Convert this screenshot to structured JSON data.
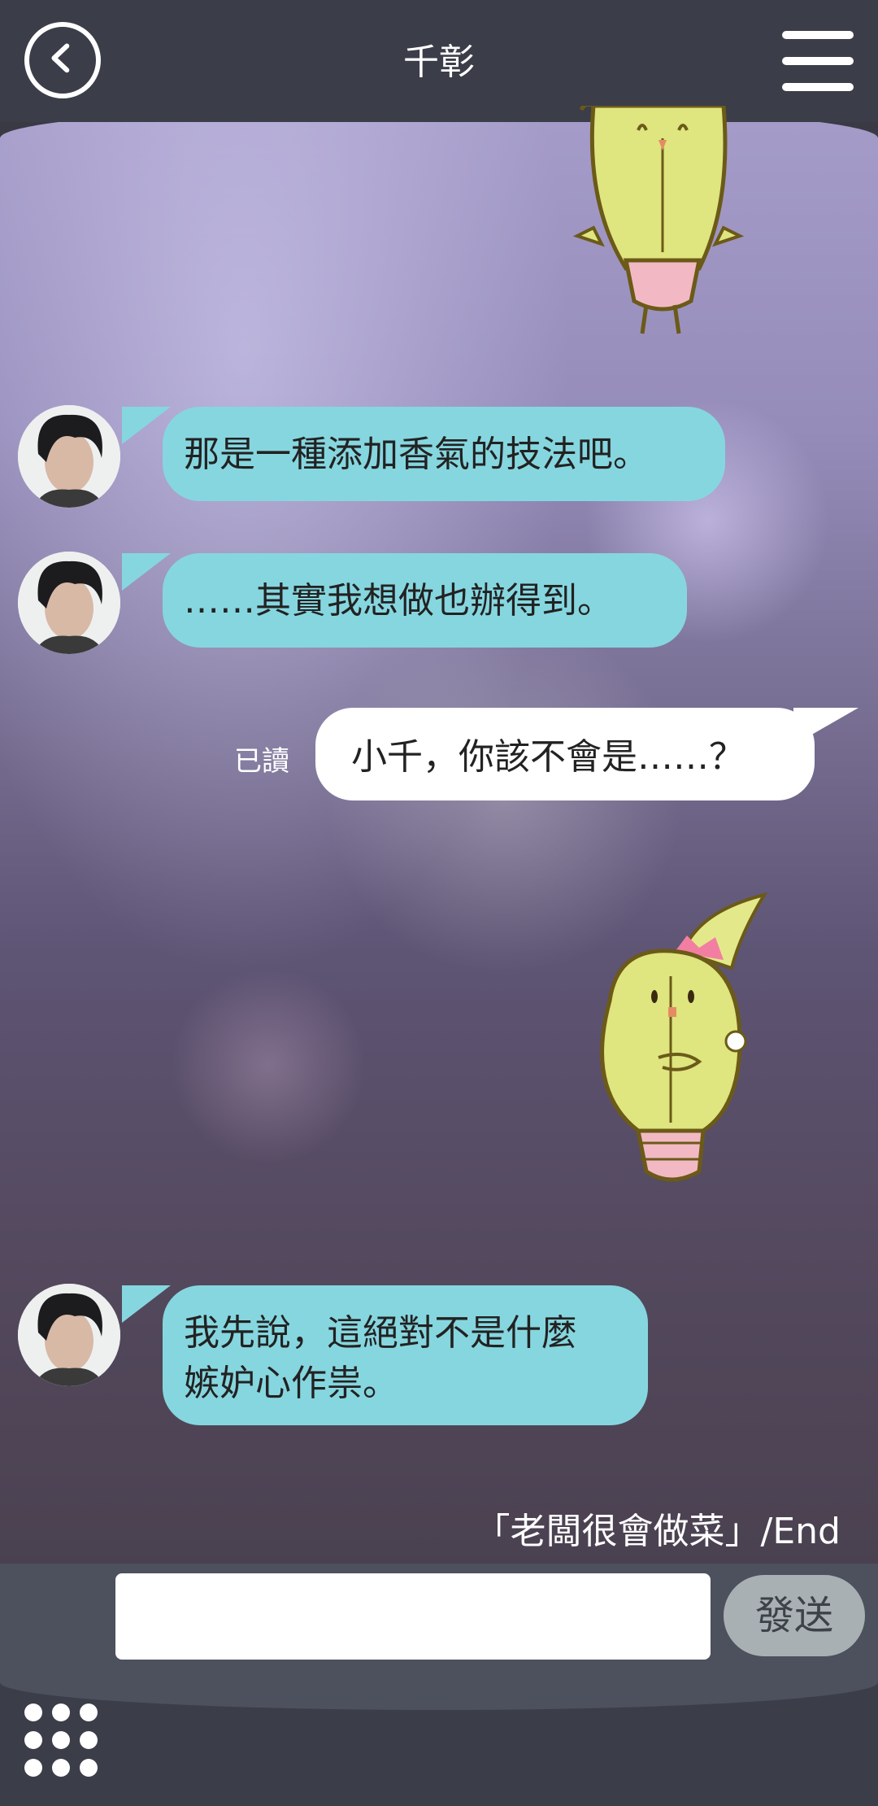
{
  "header": {
    "title": "千彰",
    "back_icon": "chevron-left-icon",
    "menu_icon": "hamburger-menu-icon"
  },
  "messages": [
    {
      "sender": "contact",
      "text": "那是一種添加香氣的技法吧。"
    },
    {
      "sender": "contact",
      "text": "……其實我想做也辦得到。"
    },
    {
      "sender": "self",
      "text": "小千，你該不會是……？",
      "status": "已讀"
    },
    {
      "sender": "contact",
      "lines": [
        "我先說，這絕對不是什麼",
        "嫉妒心作祟。"
      ]
    }
  ],
  "stickers": [
    "cactus-upside-down-sticker",
    "cactus-thinking-sticker"
  ],
  "story_end": "「老闆很會做菜」/End",
  "composer": {
    "input_value": "",
    "send_label": "發送"
  },
  "footer": {
    "apps_icon": "grid-dots-icon"
  },
  "colors": {
    "bar": "#3b3d49",
    "contact_bubble": "#86d6df",
    "self_bubble": "#ffffff",
    "send_button": "#a8b0b3"
  }
}
